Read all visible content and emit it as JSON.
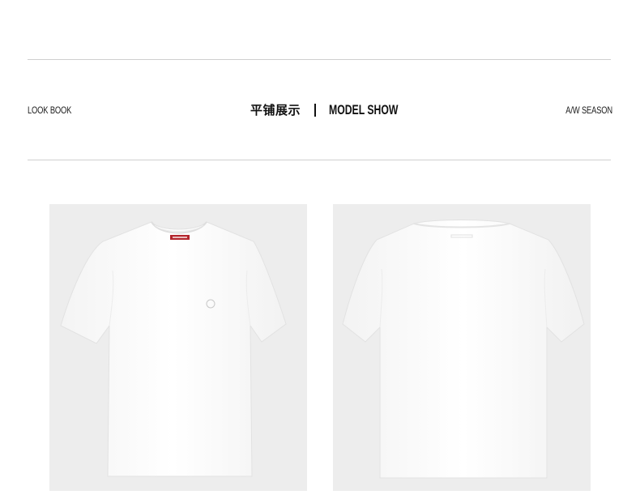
{
  "header": {
    "left_label": "LOOK BOOK",
    "title_cn": "平铺展示",
    "title_en": "MODEL SHOW",
    "right_label": "A/W SEASON"
  },
  "photos": [
    {
      "view": "front",
      "icon": "tshirt-front-icon",
      "color": "#ffffff"
    },
    {
      "view": "back",
      "icon": "tshirt-back-icon",
      "color": "#ffffff"
    }
  ],
  "colors": {
    "rule": "#cfcfcf",
    "photo_background": "#ededed",
    "label_accent": "#b3262d"
  }
}
